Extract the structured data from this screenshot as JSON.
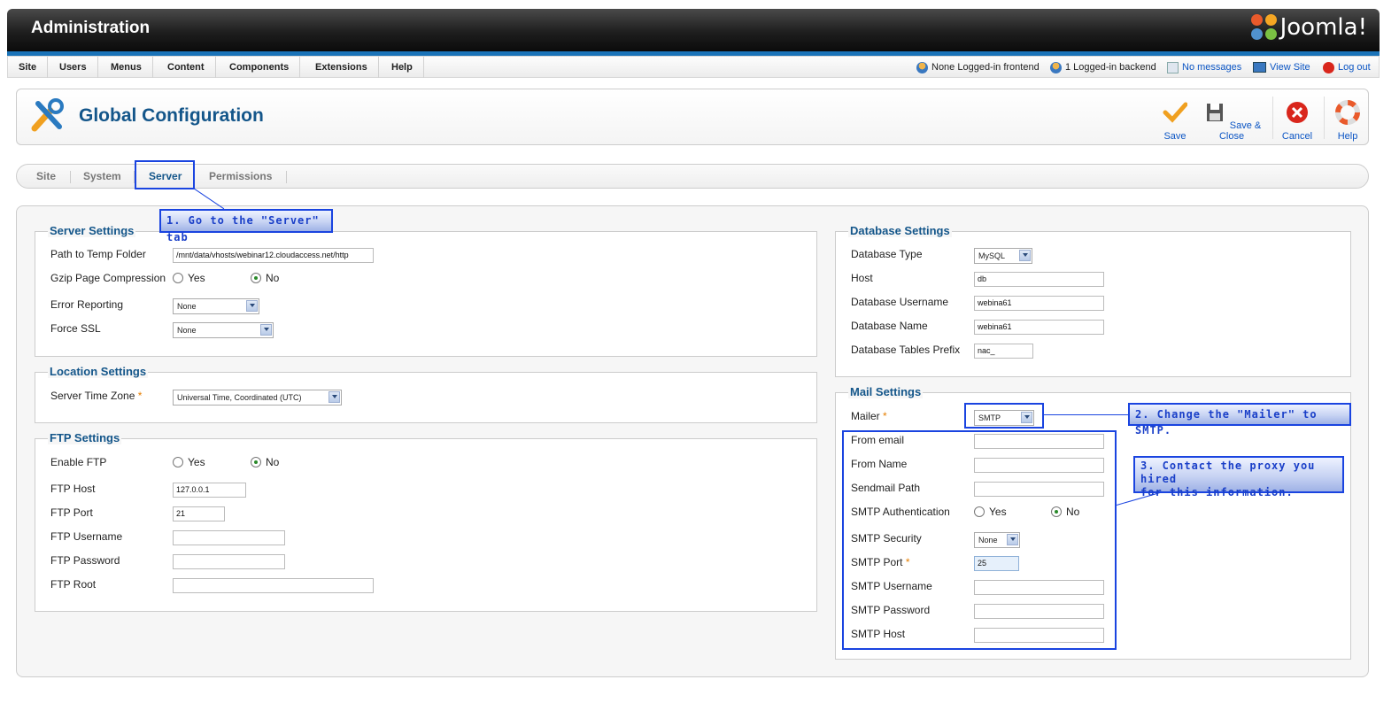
{
  "header": {
    "title": "Administration",
    "brand": "Joomla!"
  },
  "menu": [
    "Site",
    "Users",
    "Menus",
    "Content",
    "Components",
    "Extensions",
    "Help"
  ],
  "status": {
    "frontend": "None Logged-in frontend",
    "backend": "1 Logged-in backend",
    "messages": "No messages",
    "view_site": "View Site",
    "logout": "Log out"
  },
  "toolbar": {
    "page_title": "Global Configuration",
    "save": "Save",
    "save_close": "Save & Close",
    "cancel": "Cancel",
    "help": "Help"
  },
  "tabs": [
    "Site",
    "System",
    "Server",
    "Permissions"
  ],
  "active_tab": "Server",
  "server_settings": {
    "legend": "Server Settings",
    "temp_label": "Path to Temp Folder",
    "temp_value": "/mnt/data/vhosts/webinar12.cloudaccess.net/http",
    "gzip_label": "Gzip Page Compression",
    "gzip_yes": "Yes",
    "gzip_no": "No",
    "gzip_selected": "No",
    "error_label": "Error Reporting",
    "error_value": "None",
    "ssl_label": "Force SSL",
    "ssl_value": "None"
  },
  "location_settings": {
    "legend": "Location Settings",
    "tz_label": "Server Time Zone",
    "tz_required": "*",
    "tz_value": "Universal Time, Coordinated (UTC)"
  },
  "ftp_settings": {
    "legend": "FTP Settings",
    "enable_label": "Enable FTP",
    "enable_yes": "Yes",
    "enable_no": "No",
    "host_label": "FTP Host",
    "host_value": "127.0.0.1",
    "port_label": "FTP Port",
    "port_value": "21",
    "user_label": "FTP Username",
    "user_value": "",
    "pass_label": "FTP Password",
    "pass_value": "",
    "root_label": "FTP Root",
    "root_value": ""
  },
  "database_settings": {
    "legend": "Database Settings",
    "type_label": "Database Type",
    "type_value": "MySQL",
    "host_label": "Host",
    "host_value": "db",
    "user_label": "Database Username",
    "user_value": "webina61",
    "name_label": "Database Name",
    "name_value": "webina61",
    "prefix_label": "Database Tables Prefix",
    "prefix_value": "nac_"
  },
  "mail_settings": {
    "legend": "Mail Settings",
    "mailer_label": "Mailer",
    "mailer_required": "*",
    "mailer_value": "SMTP",
    "from_email_label": "From email",
    "from_email_value": "",
    "from_name_label": "From Name",
    "from_name_value": "",
    "sendmail_label": "Sendmail Path",
    "sendmail_value": "",
    "smtp_auth_label": "SMTP Authentication",
    "smtp_auth_yes": "Yes",
    "smtp_auth_no": "No",
    "smtp_security_label": "SMTP Security",
    "smtp_security_value": "None",
    "smtp_port_label": "SMTP Port",
    "smtp_port_required": "*",
    "smtp_port_value": "25",
    "smtp_user_label": "SMTP Username",
    "smtp_user_value": "",
    "smtp_pass_label": "SMTP Password",
    "smtp_pass_value": "",
    "smtp_host_label": "SMTP Host",
    "smtp_host_value": ""
  },
  "callouts": {
    "step1": "1. Go to the \"Server\" tab",
    "step2": "2. Change the \"Mailer\" to SMTP.",
    "step3_line1": "3. Contact the proxy you hired",
    "step3_line2": "for this information."
  },
  "colors": {
    "accent": "#14568a",
    "callout": "#1a44e0",
    "header_bar": "#1a73b8"
  }
}
